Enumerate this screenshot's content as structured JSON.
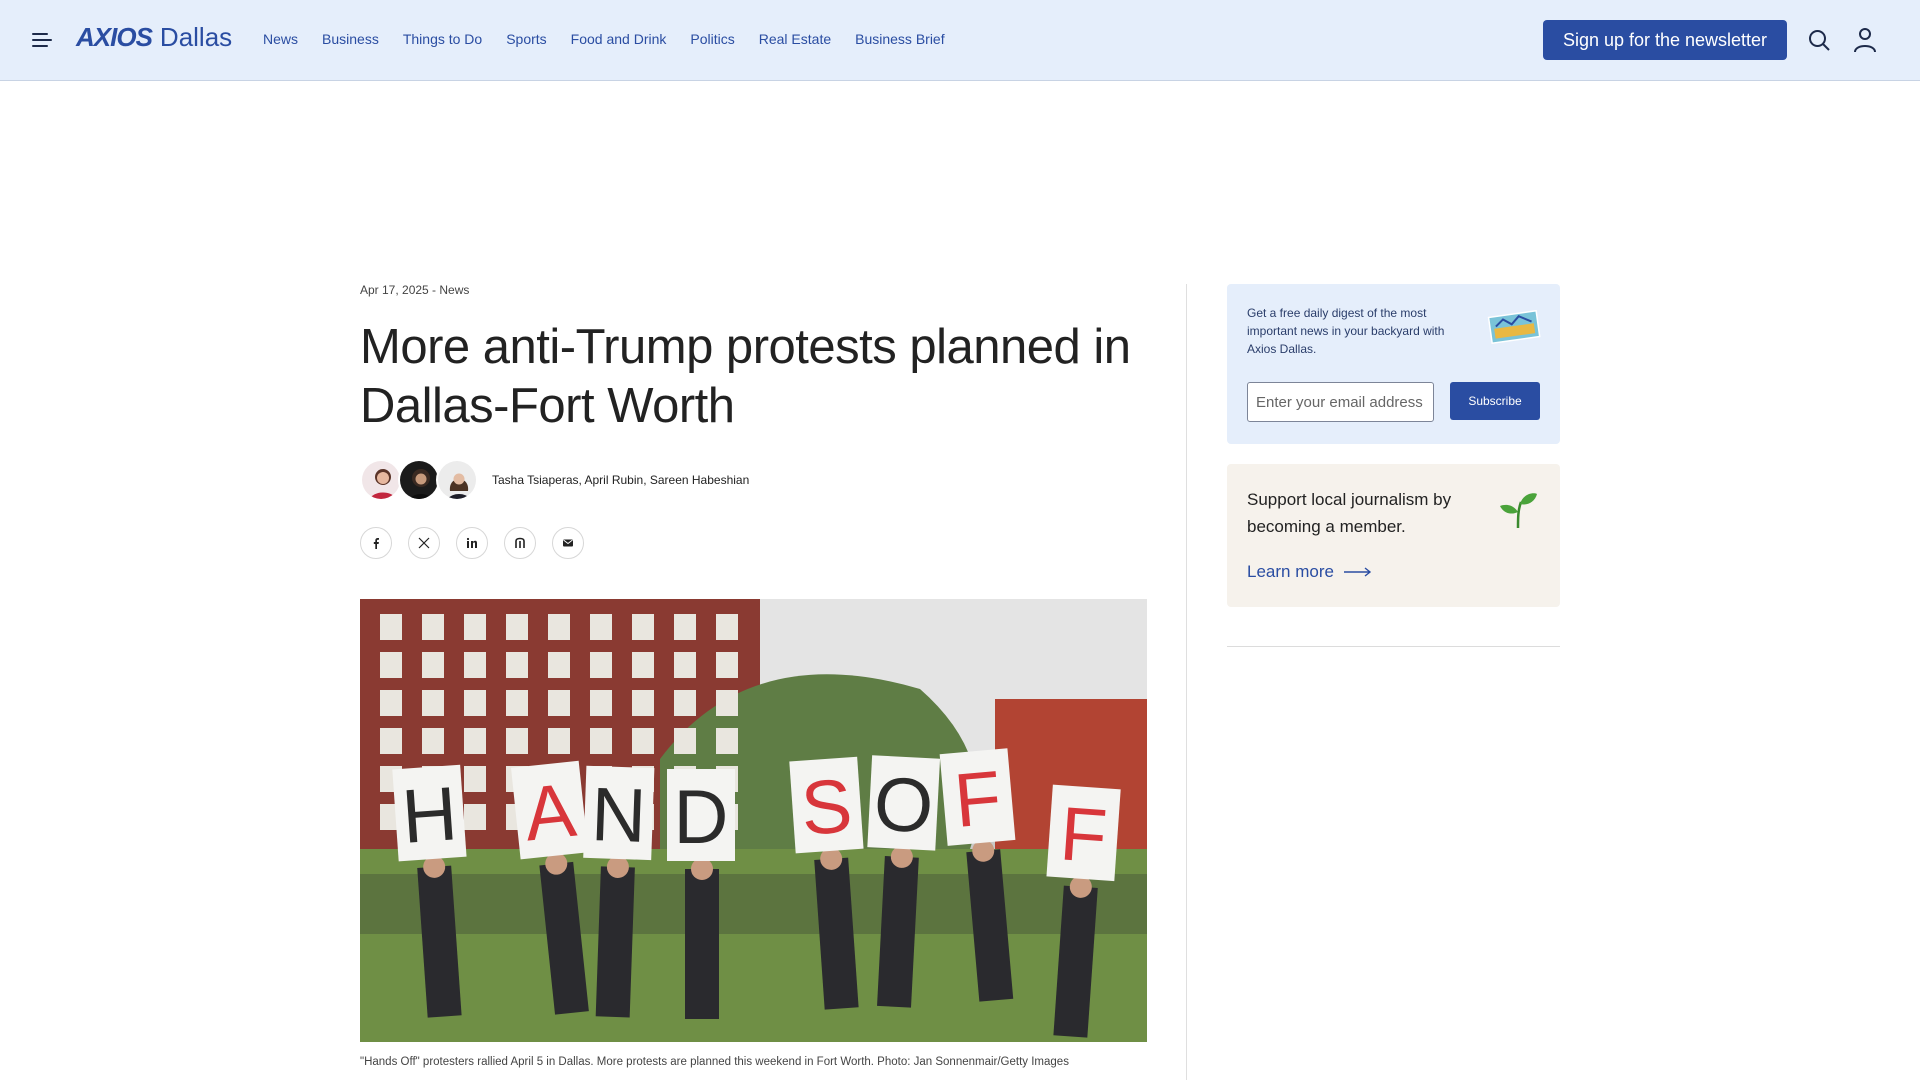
{
  "header": {
    "logo_brand": "AXIOS",
    "logo_city": "Dallas",
    "nav": [
      "News",
      "Business",
      "Things to Do",
      "Sports",
      "Food and Drink",
      "Politics",
      "Real Estate",
      "Business Brief"
    ],
    "signup_label": "Sign up for the newsletter",
    "icons": [
      "menu-icon",
      "search-icon",
      "user-icon"
    ]
  },
  "article": {
    "meta": "Apr 17, 2025 - News",
    "title": "More anti-Trump protests planned in Dallas-Fort Worth",
    "authors": "Tasha Tsiaperas, April Rubin, Sareen Habeshian",
    "share_icons": [
      "facebook-icon",
      "x-icon",
      "linkedin-icon",
      "threads-icon",
      "email-icon"
    ],
    "photo_sign_letters": [
      "H",
      "A",
      "N",
      "D",
      "S",
      "O",
      "F",
      "F"
    ],
    "caption": "\"Hands Off\" protesters rallied April 5 in Dallas. More protests are planned this weekend in Fort Worth. Photo: Jan Sonnenmair/Getty Images"
  },
  "sidebar": {
    "newsletter_text": "Get a free daily digest of the most important news in your backyard with Axios Dallas.",
    "email_placeholder": "Enter your email address",
    "subscribe_label": "Subscribe",
    "member_text": "Support local journalism by becoming a member.",
    "learn_more": "Learn more"
  },
  "colors": {
    "brand": "#2a4da2",
    "header_bg": "#e5eefb",
    "member_bg": "#f6f2ec"
  }
}
